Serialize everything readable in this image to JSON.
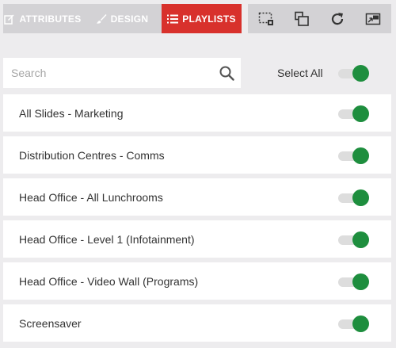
{
  "tabs": [
    {
      "label": "ATTRIBUTES",
      "icon": "edit-icon",
      "active": false
    },
    {
      "label": "DESIGN",
      "icon": "brush-icon",
      "active": false
    },
    {
      "label": "PLAYLISTS",
      "icon": "list-icon",
      "active": true
    }
  ],
  "toolbar": {
    "icons": [
      "select-region-icon",
      "copy-icon",
      "refresh-icon",
      "screen-mirror-icon"
    ]
  },
  "search": {
    "placeholder": "Search",
    "value": ""
  },
  "select_all": {
    "label": "Select All",
    "on": true
  },
  "playlists": [
    {
      "label": "All Slides - Marketing",
      "on": true
    },
    {
      "label": "Distribution Centres - Comms",
      "on": true
    },
    {
      "label": "Head Office - All Lunchrooms",
      "on": true
    },
    {
      "label": "Head Office - Level 1 (Infotainment)",
      "on": true
    },
    {
      "label": "Head Office - Video Wall (Programs)",
      "on": true
    },
    {
      "label": "Screensaver",
      "on": true
    }
  ],
  "colors": {
    "accent": "#d8312c",
    "toggle_on": "#1e8e3e",
    "toolbar_bg": "#d3d2d5",
    "panel_bg": "#edecee"
  }
}
